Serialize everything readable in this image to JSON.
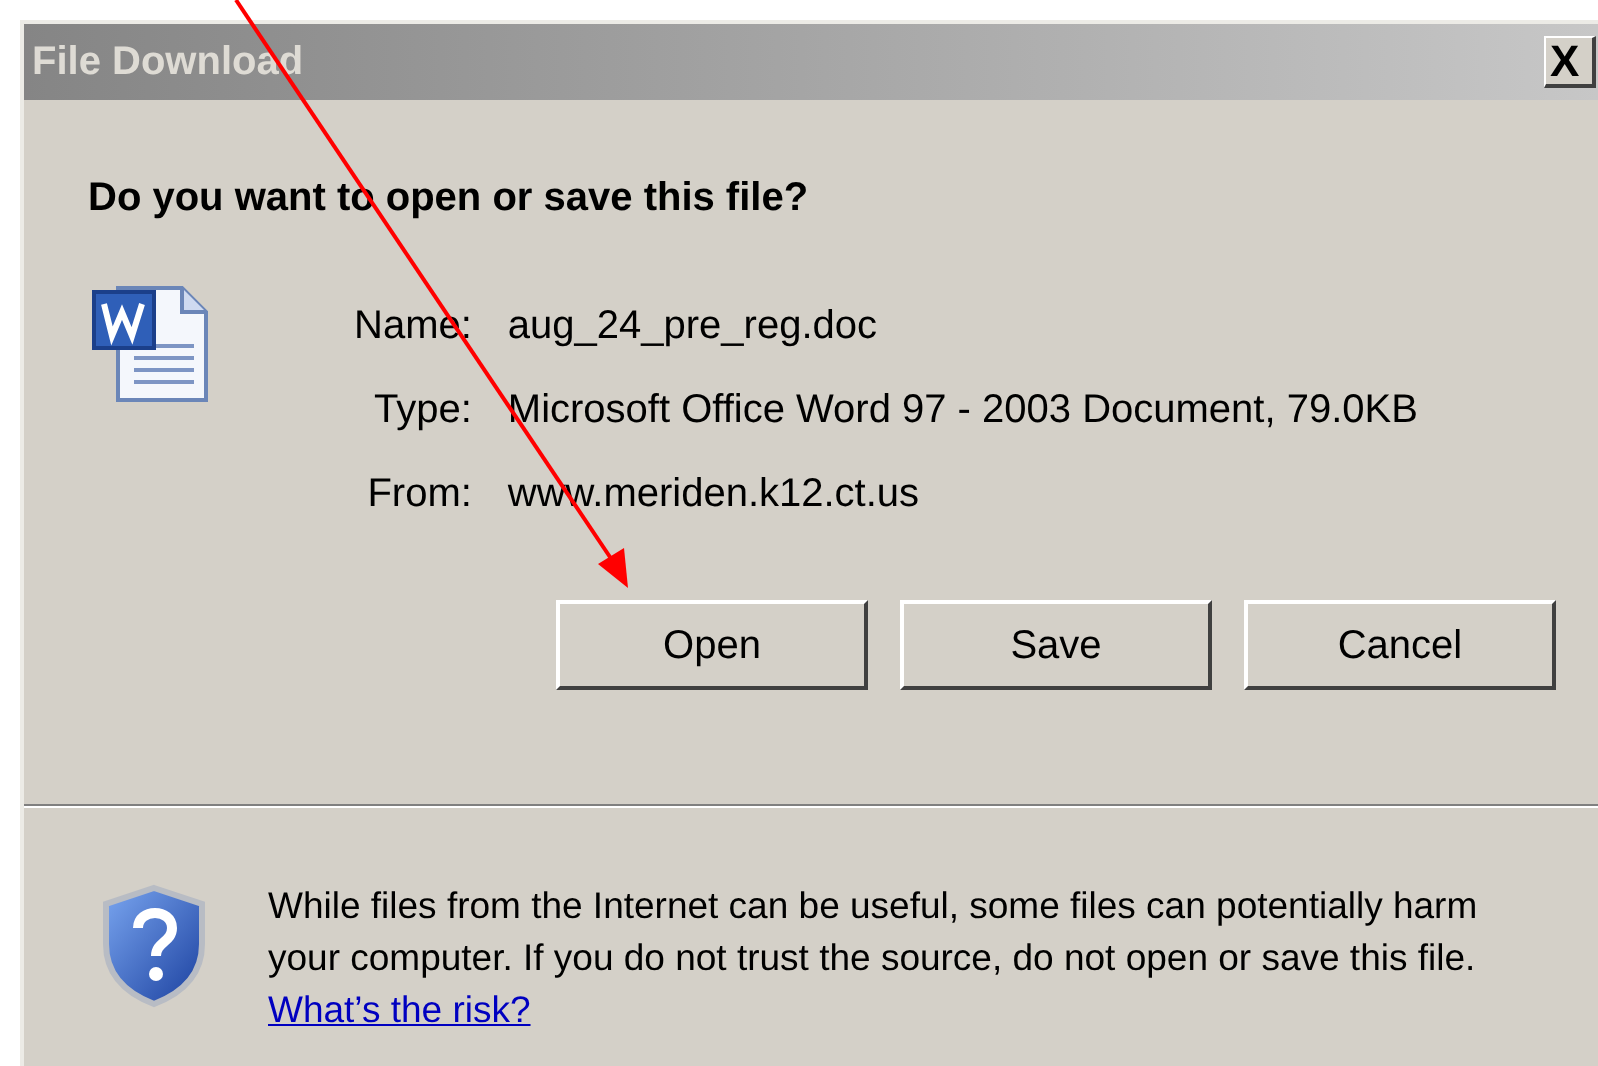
{
  "window": {
    "title": "File Download",
    "close": "X"
  },
  "heading": "Do you want to open or save this file?",
  "fields": [
    {
      "label": "Name:",
      "value": "aug_24_pre_reg.doc"
    },
    {
      "label": "Type:",
      "value": "Microsoft Office Word 97 - 2003 Document, 79.0KB"
    },
    {
      "label": "From:",
      "value": "www.meriden.k12.ct.us"
    }
  ],
  "buttons": [
    "Open",
    "Save",
    "Cancel"
  ],
  "warning": {
    "text": "While files from the Internet can be useful, some files can potentially harm your computer. If you do not trust the source, do not open or save this file.",
    "link": "What’s the risk?"
  }
}
